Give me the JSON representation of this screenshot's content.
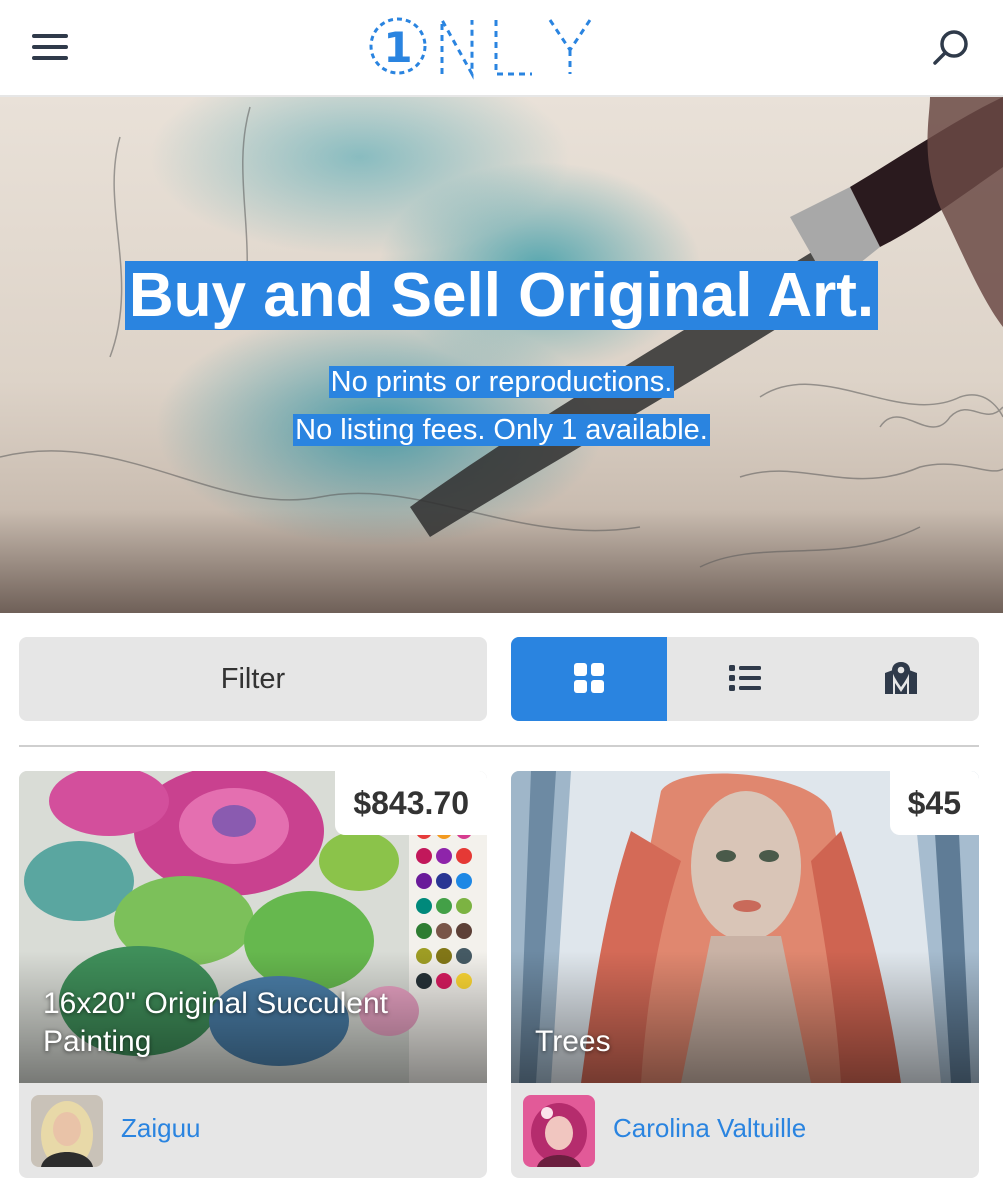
{
  "header": {
    "logo_text": "1NLY",
    "menu_icon": "hamburger-menu-icon",
    "search_icon": "search-icon"
  },
  "hero": {
    "title": "Buy and Sell Original Art.",
    "subtitle_line1": "No prints or reproductions.",
    "subtitle_line2": "No listing fees. Only 1 available."
  },
  "toolbar": {
    "filter_label": "Filter",
    "views": [
      {
        "icon": "grid-view-icon",
        "active": true
      },
      {
        "icon": "list-view-icon",
        "active": false
      },
      {
        "icon": "map-view-icon",
        "active": false
      }
    ]
  },
  "listings": [
    {
      "price": "$843.70",
      "title": "16x20'' Original Succulent Painting",
      "artist": "Zaiguu"
    },
    {
      "price": "$45",
      "title": "Trees",
      "artist": "Carolina Valtuille"
    }
  ],
  "colors": {
    "accent": "#2a84e0",
    "button_bg": "#e6e6e6",
    "text_dark": "#333333"
  }
}
